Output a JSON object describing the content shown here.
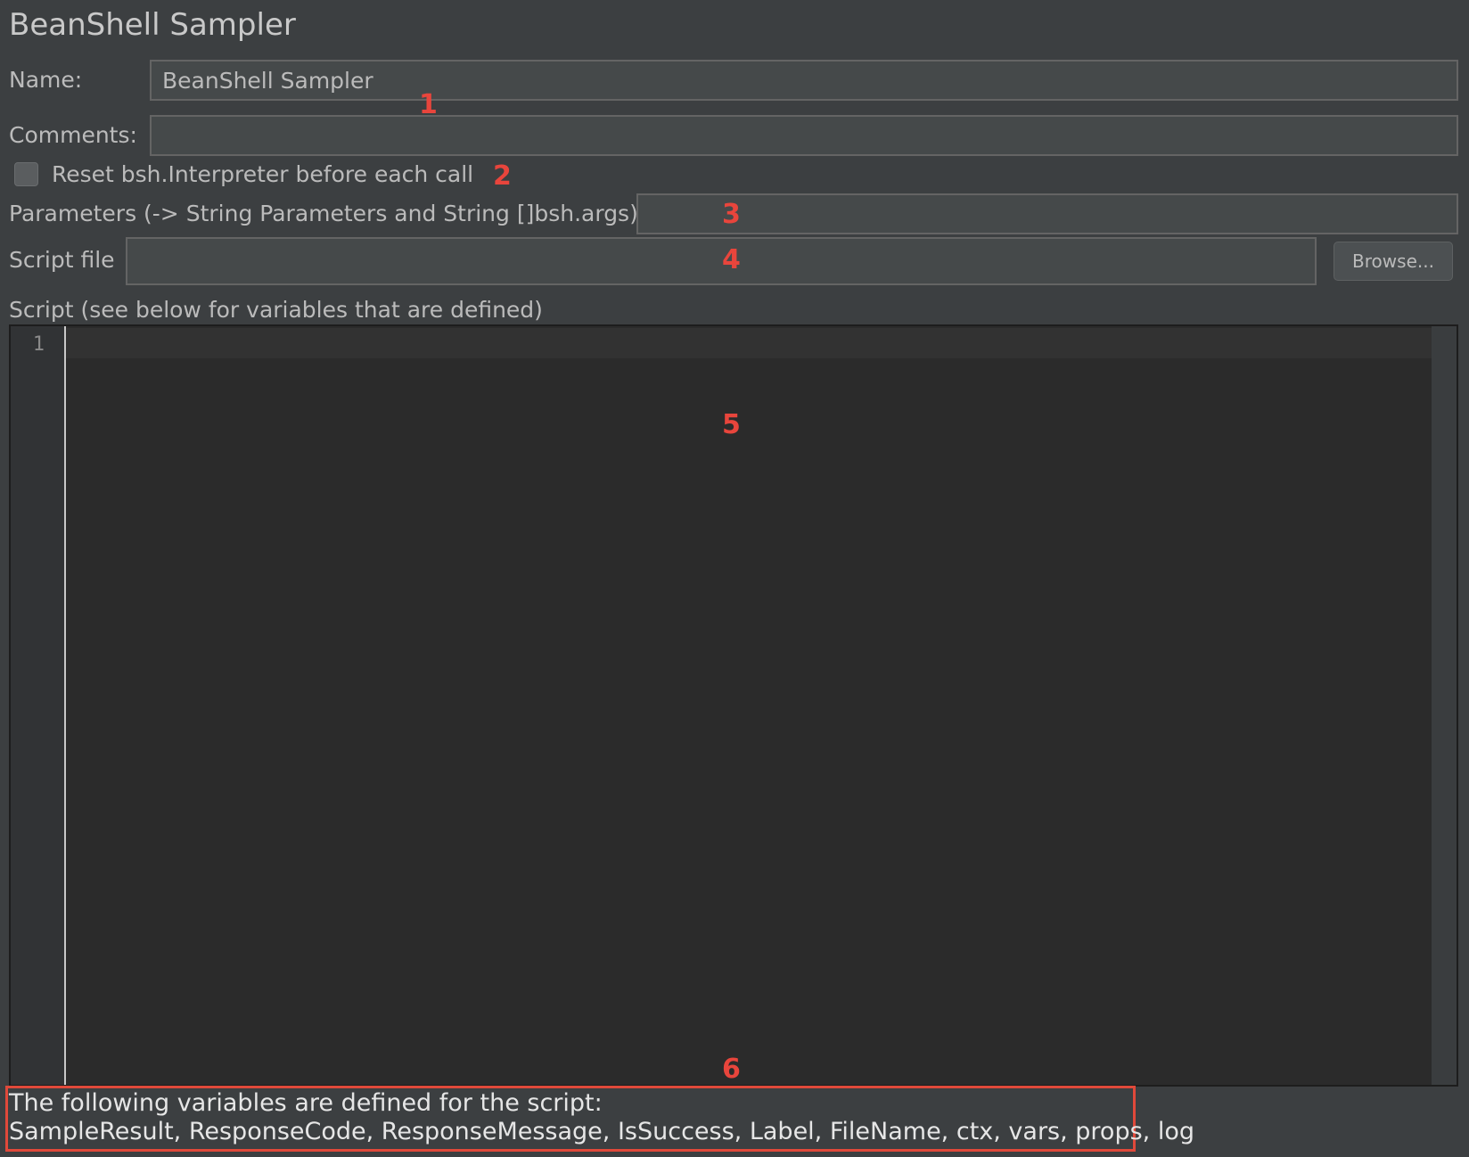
{
  "panel": {
    "title": "BeanShell Sampler"
  },
  "form": {
    "name_label": "Name:",
    "name_value": "BeanShell Sampler",
    "comments_label": "Comments:",
    "comments_value": "",
    "reset_label": "Reset bsh.Interpreter before each call",
    "reset_checked": false,
    "parameters_label": "Parameters (-> String Parameters and String []bsh.args)",
    "parameters_value": "",
    "script_file_label": "Script file",
    "script_file_value": "",
    "browse_label": "Browse...",
    "script_label": "Script (see below for variables that are defined)"
  },
  "editor": {
    "line_numbers": [
      "1"
    ]
  },
  "variables": {
    "heading": "The following variables are defined for the script:",
    "list": "SampleResult, ResponseCode, ResponseMessage, IsSuccess, Label, FileName, ctx, vars, props, log"
  },
  "annotations": {
    "m1": "1",
    "m2": "2",
    "m3": "3",
    "m4": "4",
    "m5": "5",
    "m6": "6",
    "marker_color": "#e8453c"
  },
  "colors": {
    "background": "#3c3f41",
    "field": "#45494a",
    "editor": "#2b2b2b",
    "highlight_box": "#e0493a"
  }
}
